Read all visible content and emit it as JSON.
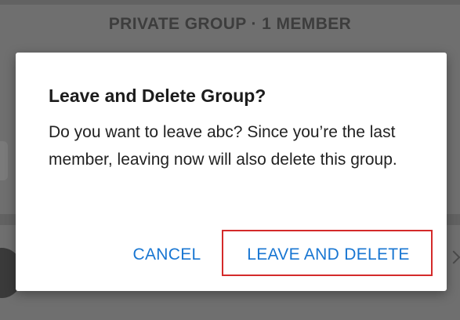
{
  "background": {
    "group_meta": "PRIVATE GROUP · 1 MEMBER"
  },
  "dialog": {
    "title": "Leave and Delete Group?",
    "message": "Do you want to leave abc? Since you’re the last member, leaving now will also delete this group.",
    "buttons": {
      "cancel_label": "CANCEL",
      "confirm_label": "LEAVE AND DELETE"
    }
  },
  "colors": {
    "accent": "#1876d2",
    "highlight": "#d42a2a",
    "scrim": "#6f6f6f"
  },
  "icons": {
    "background_forward": "chevron-right-icon"
  }
}
